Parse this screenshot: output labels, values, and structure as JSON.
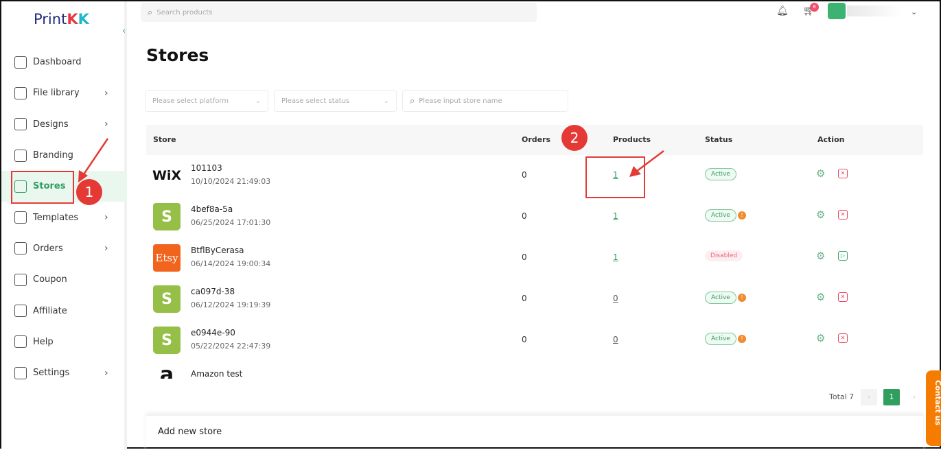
{
  "logo": {
    "text": "Print",
    "k1": "K",
    "k2": "K"
  },
  "sidebar": {
    "items": [
      {
        "label": "Dashboard",
        "icon": "chart-monitor-icon",
        "chevron": false
      },
      {
        "label": "File library",
        "icon": "image-icon",
        "chevron": true
      },
      {
        "label": "Designs",
        "icon": "design-icon",
        "chevron": true
      },
      {
        "label": "Branding",
        "icon": "tag-icon",
        "chevron": false
      },
      {
        "label": "Stores",
        "icon": "store-icon",
        "chevron": false,
        "active": true
      },
      {
        "label": "Templates",
        "icon": "template-icon",
        "chevron": true
      },
      {
        "label": "Orders",
        "icon": "orders-icon",
        "chevron": true
      },
      {
        "label": "Coupon",
        "icon": "coupon-icon",
        "chevron": false
      },
      {
        "label": "Affiliate",
        "icon": "affiliate-icon",
        "chevron": false
      },
      {
        "label": "Help",
        "icon": "help-icon",
        "chevron": false
      },
      {
        "label": "Settings",
        "icon": "settings-icon",
        "chevron": true
      }
    ]
  },
  "header": {
    "search_placeholder": "Search products",
    "cart_count": "8"
  },
  "page": {
    "title": "Stores"
  },
  "filters": {
    "platform": "Please select platform",
    "status": "Please select status",
    "store_name": "Please input store name"
  },
  "table": {
    "columns": [
      "Store",
      "Orders",
      "Products",
      "Status",
      "Action"
    ],
    "rows": [
      {
        "platform": "WiX",
        "name": "101103",
        "date": "10/10/2024 21:49:03",
        "orders": "0",
        "products": "1",
        "status": "Active",
        "warning": false,
        "action2": "delete"
      },
      {
        "platform": "S",
        "name": "4bef8a-5a",
        "date": "06/25/2024 17:01:30",
        "orders": "0",
        "products": "1",
        "status": "Active",
        "warning": true,
        "action2": "delete"
      },
      {
        "platform": "Etsy",
        "name": "BtflByCerasa",
        "date": "06/14/2024 19:00:34",
        "orders": "0",
        "products": "1",
        "status": "Disabled",
        "warning": false,
        "action2": "enable"
      },
      {
        "platform": "S",
        "name": "ca097d-38",
        "date": "06/12/2024 19:19:39",
        "orders": "0",
        "products": "0",
        "status": "Active",
        "warning": true,
        "action2": "delete"
      },
      {
        "platform": "S",
        "name": "e0944e-90",
        "date": "05/22/2024 22:47:39",
        "orders": "0",
        "products": "0",
        "status": "Active",
        "warning": true,
        "action2": "delete"
      },
      {
        "platform": "a",
        "name": "Amazon test",
        "date": "",
        "orders": "",
        "products": "",
        "status": "",
        "warning": false,
        "action2": ""
      }
    ]
  },
  "pagination": {
    "total": "Total 7",
    "current": "1"
  },
  "add_store": "Add new store",
  "contact": "Contact us",
  "annotations": {
    "step1": "1",
    "step2": "2"
  },
  "colors": {
    "accent": "#2f9e5f",
    "annotation": "#e53935",
    "contact": "#f57c00"
  }
}
